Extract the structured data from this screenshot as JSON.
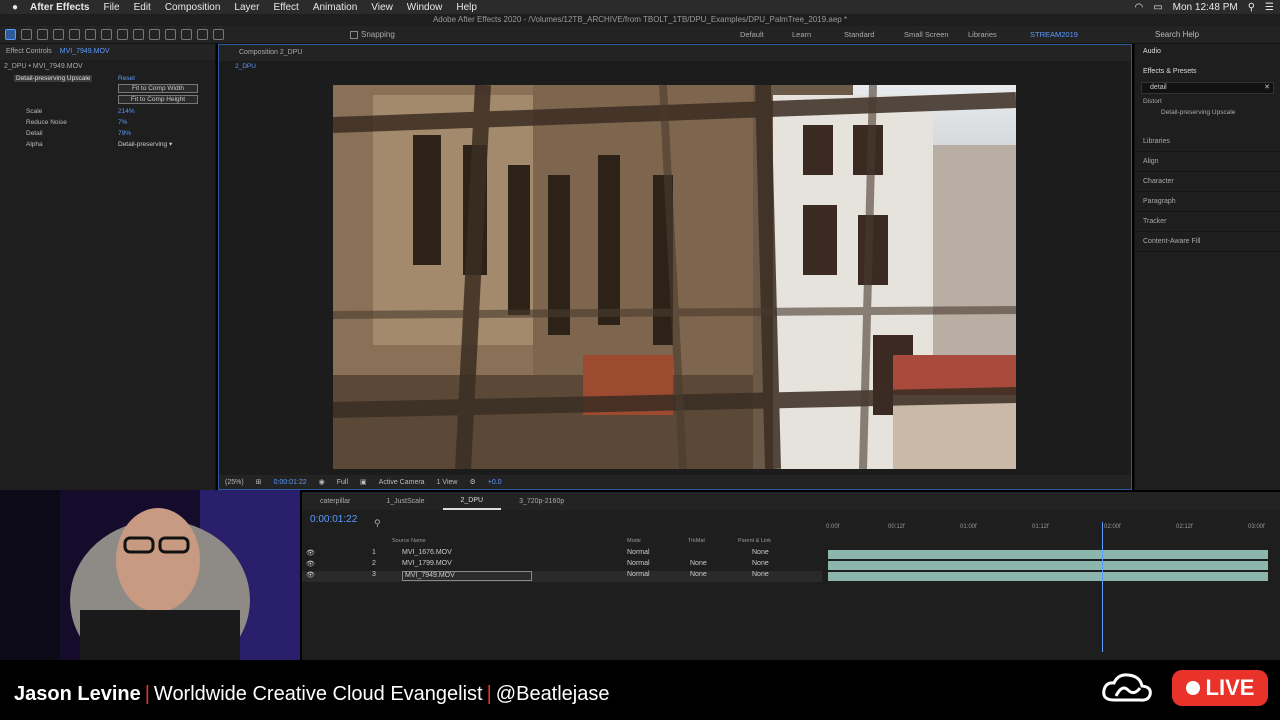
{
  "menubar": {
    "app": "After Effects",
    "items": [
      "File",
      "Edit",
      "Composition",
      "Layer",
      "Effect",
      "Animation",
      "View",
      "Window",
      "Help"
    ],
    "clock": "Mon 12:48 PM"
  },
  "titlebar": "Adobe After Effects 2020 - /Volumes/12TB_ARCHIVE/from TBOLT_1TB/DPU_Examples/DPU_PalmTree_2019.aep *",
  "toolbar": {
    "snapping": "Snapping",
    "workspaces": [
      "Default",
      "Learn",
      "Standard",
      "Small Screen",
      "Libraries",
      "STREAM2019"
    ],
    "active_workspace": "STREAM2019",
    "search_help": "Search Help"
  },
  "effect_controls": {
    "tab_label": "Effect Controls",
    "tab_layer": "MVI_7949.MOV",
    "subtitle": "2_DPU • MVI_7949.MOV",
    "effect_name": "Detail-preserving Upscale",
    "reset": "Reset",
    "btn_fit_width": "Fit to Comp Width",
    "btn_fit_height": "Fit to Comp Height",
    "params": [
      {
        "name": "Scale",
        "value": "214%"
      },
      {
        "name": "Reduce Noise",
        "value": "7%"
      },
      {
        "name": "Detail",
        "value": "79%"
      },
      {
        "name": "Alpha",
        "value": "Detail-preserving"
      }
    ]
  },
  "composition": {
    "tab_label": "Composition 2_DPU",
    "sub_tab": "2_DPU",
    "zoom": "(25%)",
    "timecode": "0:00:01:22",
    "resolution": "Full",
    "camera": "Active Camera",
    "views": "1 View",
    "exposure": "+0.0"
  },
  "right_panel": {
    "audio": "Audio",
    "effects_presets": "Effects & Presets",
    "search_value": "detail",
    "tree_group": "Distort",
    "tree_item": "Detail-preserving Upscale",
    "panels": [
      "Libraries",
      "Align",
      "Character",
      "Paragraph",
      "Tracker",
      "Content-Aware Fill"
    ]
  },
  "timeline": {
    "tabs": [
      "caterpillar",
      "1_JustScale",
      "2_DPU",
      "3_720p-2160p"
    ],
    "active_tab": "2_DPU",
    "timecode": "0:00:01:22",
    "col_source": "Source Name",
    "col_mode": "Mode",
    "col_trkmat": "TrkMat",
    "col_parent": "Parent & Link",
    "layers": [
      {
        "num": "1",
        "name": "MVI_1676.MOV",
        "mode": "Normal",
        "trkmat": "",
        "parent": "None"
      },
      {
        "num": "2",
        "name": "MVI_1799.MOV",
        "mode": "Normal",
        "trkmat": "None",
        "parent": "None"
      },
      {
        "num": "3",
        "name": "MVI_7949.MOV",
        "mode": "Normal",
        "trkmat": "None",
        "parent": "None"
      }
    ],
    "ruler": [
      "0:00f",
      "00:12f",
      "01:00f",
      "01:12f",
      "02:00f",
      "02:12f",
      "03:00f"
    ]
  },
  "overlay": {
    "presenter": "Jason Levine",
    "title": "Worldwide Creative Cloud Evangelist",
    "handle": "@Beatlejase",
    "live": "LIVE"
  }
}
